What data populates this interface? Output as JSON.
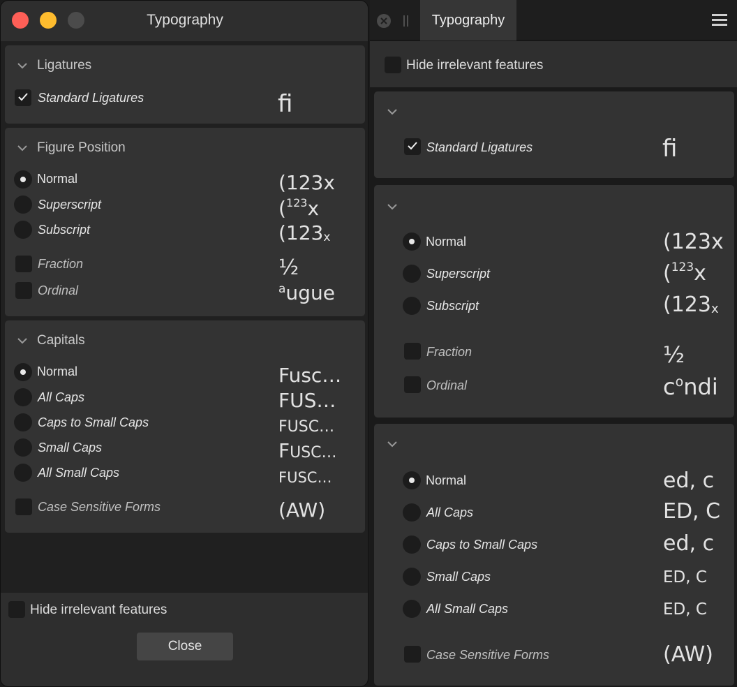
{
  "left": {
    "title": "Typography",
    "sections": {
      "ligatures": {
        "title": "Ligatures",
        "standard": {
          "label": "Standard Ligatures",
          "sample": "fi",
          "checked": true
        }
      },
      "figure": {
        "title": "Figure Position",
        "normal": {
          "label": "Normal",
          "sample": "(123x"
        },
        "superscript": {
          "label": "Superscript",
          "sample_base": "(",
          "sample_sup": "123",
          "sample_tail": "x"
        },
        "subscript": {
          "label": "Subscript",
          "sample_base": "(123",
          "sample_sub": "x"
        },
        "fraction": {
          "label": "Fraction",
          "sample": "½"
        },
        "ordinal": {
          "label": "Ordinal",
          "sample_sup": "a",
          "sample_tail": "ugue"
        }
      },
      "capitals": {
        "title": "Capitals",
        "normal": {
          "label": "Normal",
          "sample": "Fusc…"
        },
        "all_caps": {
          "label": "All Caps",
          "sample": "FUS…"
        },
        "caps_small": {
          "label": "Caps to Small Caps",
          "sample": "FUSC…"
        },
        "small_caps": {
          "label": "Small Caps",
          "sample_big": "F",
          "sample_small": "USC…"
        },
        "all_small": {
          "label": "All Small Caps",
          "sample": "FUSC…"
        },
        "case_sensitive": {
          "label": "Case Sensitive Forms",
          "sample": "(AW)"
        }
      }
    },
    "hide_irrelevant": "Hide irrelevant features",
    "close_label": "Close"
  },
  "right": {
    "tab_title": "Typography",
    "hide_irrelevant": "Hide irrelevant features",
    "ligatures": {
      "standard": {
        "label": "Standard Ligatures",
        "sample": "fi"
      }
    },
    "figure": {
      "normal": {
        "label": "Normal",
        "sample": "(123x"
      },
      "superscript": {
        "label": "Superscript",
        "sample_base": "(",
        "sample_sup": "123",
        "sample_tail": "x"
      },
      "subscript": {
        "label": "Subscript",
        "sample_base": "(123",
        "sample_sub": "x"
      },
      "fraction": {
        "label": "Fraction",
        "sample": "½"
      },
      "ordinal": {
        "label": "Ordinal",
        "sample_base": "c",
        "sample_sup": "o",
        "sample_tail": "ndi"
      }
    },
    "capitals": {
      "normal": {
        "label": "Normal",
        "sample": "ed, c"
      },
      "all_caps": {
        "label": "All Caps",
        "sample": "ED, C"
      },
      "caps_small": {
        "label": "Caps to Small Caps",
        "sample": "ed, c"
      },
      "small_caps": {
        "label": "Small Caps",
        "sample": "ED, C"
      },
      "all_small": {
        "label": "All Small Caps",
        "sample": "ED, C"
      },
      "case_sensitive": {
        "label": "Case Sensitive Forms",
        "sample": "(AW)"
      }
    }
  },
  "icons": {
    "chevron": "chevron-down-icon",
    "check": "checkmark-icon",
    "close": "close-icon",
    "menu": "hamburger-menu-icon"
  },
  "colors": {
    "close_button": "#fe5f57",
    "minimize_button": "#febc2e",
    "panel": "#333333"
  }
}
